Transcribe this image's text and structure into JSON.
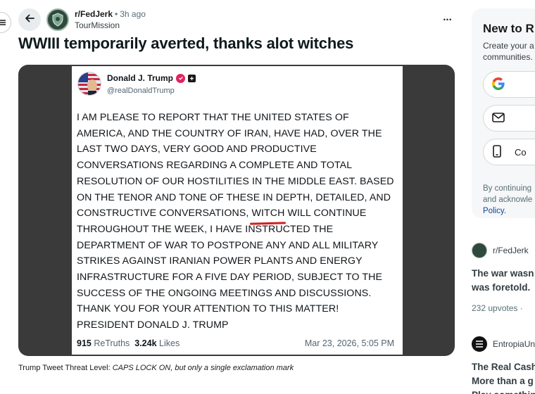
{
  "post": {
    "subreddit": "r/FedJerk",
    "separator": "•",
    "time": "3h ago",
    "author": "TourMission",
    "more": "•••",
    "title": "WWIII temporarily averted, thanks alot witches",
    "caption_prefix": "Trump Tweet Threat Level: ",
    "caption_italic": "CAPS LOCK ON, but only a single exclamation mark"
  },
  "tweet": {
    "name": "Donald J. Trump",
    "handle": "@realDonaldTrump",
    "body_before": "I AM PLEASE TO REPORT THAT THE UNITED STATES OF AMERICA, AND THE COUNTRY OF IRAN, HAVE HAD, OVER THE LAST TWO DAYS, VERY GOOD AND PRODUCTIVE CONVERSATIONS REGARDING A COMPLETE AND TOTAL RESOLUTION OF OUR HOSTILITIES IN THE MIDDLE EAST. BASED ON THE TENOR AND TONE OF THESE IN DEPTH, DETAILED, AND CONSTRUCTIVE CONVERSATIONS, ",
    "body_highlight": "WITCH",
    "body_after": " WILL CONTINUE THROUGHOUT THE WEEK, I HAVE INSTRUCTED THE DEPARTMENT OF WAR TO POSTPONE ANY AND ALL MILITARY STRIKES AGAINST IRANIAN POWER PLANTS AND ENERGY INFRASTRUCTURE FOR A FIVE DAY PERIOD, SUBJECT TO THE SUCCESS OF THE ONGOING MEETINGS AND DISCUSSIONS. THANK YOU FOR YOUR ATTENTION TO THIS MATTER! PRESIDENT DONALD J. TRUMP",
    "retruths_count": "915",
    "retruths_label": "ReTruths",
    "likes_count": "3.24k",
    "likes_label": "Likes",
    "date": "Mar 23, 2026, 5:05 PM"
  },
  "auth": {
    "title": "New to R",
    "subtitle_line1": "Create your a",
    "subtitle_line2": "communities.",
    "buttons": [
      {
        "icon": "google-icon",
        "label": ""
      },
      {
        "icon": "mail-icon",
        "label": ""
      },
      {
        "icon": "phone-icon",
        "label": "Co"
      }
    ],
    "terms_line1": "By continuing",
    "terms_line2": "and acknowle",
    "policy": "Policy."
  },
  "related": [
    {
      "sub": "r/FedJerk",
      "title_line1": "The war wasn",
      "title_line2": "was foretold.",
      "stats": "232 upvotes  ·  "
    },
    {
      "sub": "EntropiaUn",
      "title_line1": "The Real Cash",
      "title_line2": "More than a g",
      "title_line3": "Play somethin"
    }
  ]
}
